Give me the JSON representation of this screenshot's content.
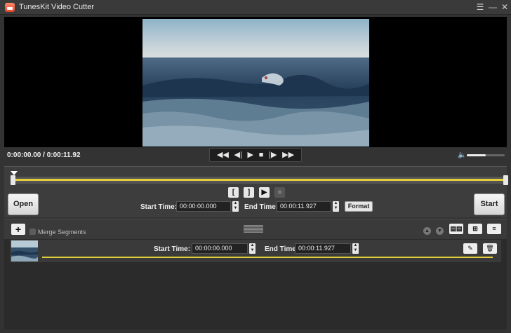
{
  "window": {
    "title": "TunesKit Video Cutter",
    "controls": {
      "menu_icon": "☰",
      "minimize_icon": "—",
      "close_icon": "✕"
    }
  },
  "player": {
    "time_readout": "0:00:00.00 / 0:00:11.92",
    "transport": {
      "rewind_icon": "◀◀",
      "prev_frame_icon": "◀|",
      "play_icon": "▶",
      "stop_icon": "■",
      "next_frame_icon": "|▶",
      "forward_icon": "▶▶"
    },
    "volume_icon": "🔈",
    "volume_level": 0.5
  },
  "editor": {
    "open_label": "Open",
    "start_label": "Start",
    "mark_in_label": "[",
    "mark_out_label": "]",
    "preview_label": "▶",
    "mark_stop_label": "■",
    "start_time_label": "Start Time:",
    "start_time_value": "00:00:00.000",
    "end_time_label": "End Time:",
    "end_time_value": "00:00:11.927",
    "spin_up": "▲",
    "spin_down": "▼",
    "format_label": "Format"
  },
  "segments": {
    "add_label": "+",
    "merge_label": "Merge Segments",
    "move_up_icon": "▲",
    "move_down_icon": "▼",
    "tools": [
      "▤▤",
      "⊞",
      "≡"
    ],
    "items": [
      {
        "start_label": "Start Time:",
        "start_value": "00:00:00.000",
        "end_label": "End Time:",
        "end_value": "00:00:11.927",
        "edit_icon": "✎",
        "delete_icon": "🗑"
      }
    ]
  },
  "colors": {
    "accent": "#e3cf3c",
    "background": "#333333",
    "player_bg": "#000000"
  }
}
